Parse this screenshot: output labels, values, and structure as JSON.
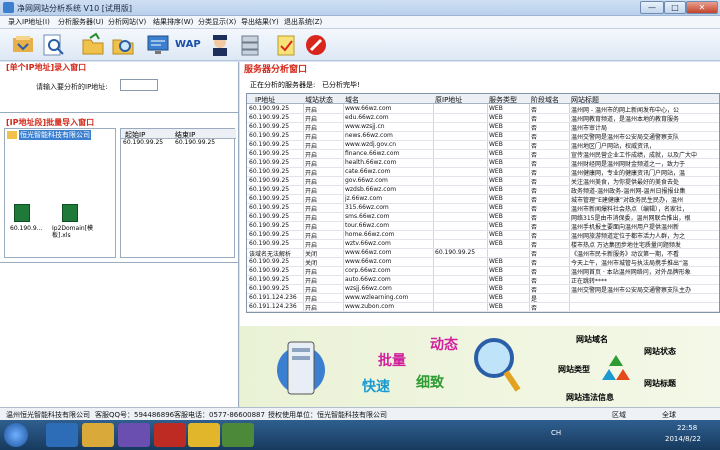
{
  "window": {
    "title": "净网网站分析系统 V10 [试用版]",
    "min": "—",
    "max": "□",
    "close": "✕"
  },
  "menu": [
    "录入IP地址(I)",
    "分析服务器(U)",
    "分析网站(V)",
    "结果排序(W)",
    "分类显示(X)",
    "导出结果(Y)",
    "退出系统(Z)"
  ],
  "toolbar": {
    "wap_label": "WAP",
    "icons": [
      "import-icon",
      "search-icon",
      "open-folder-icon",
      "magnifier-icon",
      "monitor-icon",
      "wap-icon",
      "police-icon",
      "server-icon",
      "notepad-icon",
      "stop-icon"
    ]
  },
  "left": {
    "single_title": "[单个IP地址]录入窗口",
    "ip_prompt": "请输入要分析的IP地址:",
    "ip_value": "",
    "batch_title": "[IP地址段]批量导入窗口",
    "tree_item": "恒光智能科技有限公司",
    "range_head": [
      "起始IP",
      "结束IP"
    ],
    "range_rows": [
      [
        "60.190.99.25",
        "60.190.99.25"
      ]
    ],
    "files": [
      {
        "name": "60.190.9...",
        "icon": "excel-file-icon"
      },
      {
        "name": "Ip2Domain[模板].xls",
        "icon": "excel-file-icon"
      }
    ]
  },
  "right": {
    "title": "服务器分析窗口",
    "status_label": "正在分析的服务器是:",
    "status_value": "已分析完毕!",
    "columns": [
      "IP地址",
      "域站状态",
      "域名",
      "原IP地址",
      "服务类型",
      "阶段域名",
      "网站标题"
    ],
    "rows": [
      [
        "60.190.99.25",
        "开启",
        "www.66wz.com",
        "",
        "WEB",
        "否",
        "温州网 - 温州市的网上新闻发布中心，公"
      ],
      [
        "60.190.99.25",
        "开启",
        "edu.66wz.com",
        "",
        "WEB",
        "否",
        "温州网教育频道，是温州本地的教育服务"
      ],
      [
        "60.190.99.25",
        "开启",
        "www.wzsjj.cn",
        "",
        "WEB",
        "否",
        "温州市审计局"
      ],
      [
        "60.190.99.25",
        "开启",
        "news.66wz.com",
        "",
        "WEB",
        "否",
        "温州交警网是温州市公安局交通警察支队"
      ],
      [
        "60.190.99.25",
        "开启",
        "www.wzdj.gov.cn",
        "",
        "WEB",
        "否",
        "温州地区门户网站，权威资讯，"
      ],
      [
        "60.190.99.25",
        "开启",
        "finance.66wz.com",
        "",
        "WEB",
        "否",
        "宣传温州民营企业工作成绩，成就，以及广大中"
      ],
      [
        "60.190.99.25",
        "开启",
        "health.66wz.com",
        "",
        "WEB",
        "否",
        "温州财经网是温州网财金频道之一，致力于"
      ],
      [
        "60.190.99.25",
        "开启",
        "cate.66wz.com",
        "",
        "WEB",
        "否",
        "温州健康网，专业的健康资讯门户网站，温"
      ],
      [
        "60.190.99.25",
        "开启",
        "gov.66wz.com",
        "",
        "WEB",
        "否",
        "关注温州美食，为你提供最好的美食去处"
      ],
      [
        "60.190.99.25",
        "开启",
        "wzdsb.66wz.com",
        "",
        "WEB",
        "否",
        "政务频道-温州政务-温州网-温州日报报业集"
      ],
      [
        "60.190.99.25",
        "开启",
        "jz.66wz.com",
        "",
        "WEB",
        "否",
        "城市管理“E建健康”对政务民生民办，温州"
      ],
      [
        "60.190.99.25",
        "开启",
        "315.66wz.com",
        "",
        "WEB",
        "否",
        "温州市新闻爆料社会热点（编辑），名家社，"
      ],
      [
        "60.190.99.25",
        "开启",
        "sms.66wz.com",
        "",
        "WEB",
        "否",
        "网络315是由市消保委，温州网联合推出，根"
      ],
      [
        "60.190.99.25",
        "开启",
        "tour.66wz.com",
        "",
        "WEB",
        "否",
        "温州手机报主要面向温州用户提供温州新"
      ],
      [
        "60.190.99.25",
        "开启",
        "home.66wz.com",
        "",
        "WEB",
        "否",
        "温州网旅游频道定位于都市活力人群，为之"
      ],
      [
        "60.190.99.25",
        "开启",
        "wztv.66wz.com",
        "",
        "WEB",
        "否",
        "楼市热点 万达集团步地住宅质量问题频发"
      ],
      [
        "该域名无法解析",
        "关闭",
        "www.66wz.com",
        "60.190.99.25",
        "",
        "否",
        "《温州市民卡新服务》动议第一期，不看"
      ],
      [
        "60.190.99.25",
        "关闭",
        "www.66wz.com",
        "",
        "WEB",
        "否",
        "今天上午，温州市城管与执法局携手推出“温"
      ],
      [
        "60.190.99.25",
        "开启",
        "corp.66wz.com",
        "",
        "WEB",
        "否",
        "温州网首页 · 本站温州网络问，对外品牌形象"
      ],
      [
        "60.190.99.25",
        "开启",
        "auto.66wz.com",
        "",
        "WEB",
        "否",
        "正在跳转****"
      ],
      [
        "60.190.99.25",
        "开启",
        "wzsjj.66wz.com",
        "",
        "WEB",
        "否",
        "温州交警网是温州市公安局交通警察支队主办"
      ],
      [
        "60.191.124.236",
        "开启",
        "www.wzlearning.com",
        "",
        "WEB",
        "是",
        ""
      ],
      [
        "60.191.124.236",
        "开启",
        "www.zubon.com",
        "",
        "WEB",
        "否",
        ""
      ]
    ]
  },
  "banner": {
    "text1": "批量",
    "text2": "动态",
    "text3": "快速",
    "text4": "细致",
    "tag1": "网站域名",
    "tag2": "网站状态",
    "tag3": "网站类型",
    "tag4": "网站标题",
    "tag5": "网站违法信息"
  },
  "status": {
    "company": "温州恒光智能科技有限公司",
    "qq": "客服QQ号：594486896",
    "phone": "客服电话：0577-86600887",
    "license": "授权使用单位：恒光智能科技有限公司",
    "mode": "区域",
    "region": "全球"
  },
  "taskbar": {
    "time": "22:58",
    "date": "2014/8/22",
    "lang": "CH"
  },
  "colors": {
    "title_red": "#d3281a",
    "accent_blue": "#3a7fd0"
  }
}
